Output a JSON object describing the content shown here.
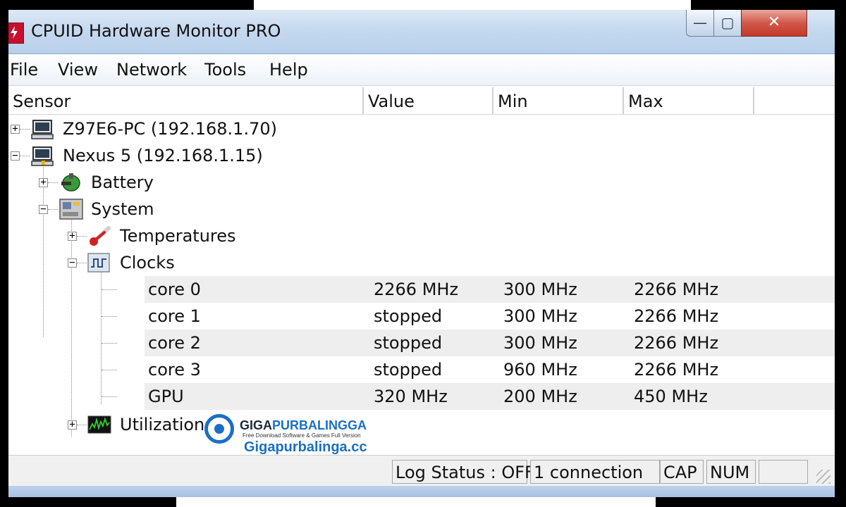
{
  "window": {
    "title": "CPUID Hardware Monitor PRO",
    "controls": {
      "minimize": "—",
      "maximize": "▢",
      "close": "✕"
    }
  },
  "menu": [
    "File",
    "View",
    "Network",
    "Tools",
    "Help"
  ],
  "columns": [
    "Sensor",
    "Value",
    "Min",
    "Max"
  ],
  "tree": {
    "hosts": [
      {
        "label": "Z97E6-PC (192.168.1.70)",
        "expander": "+",
        "icon": "computer-icon"
      },
      {
        "label": "Nexus 5 (192.168.1.15)",
        "expander": "−",
        "icon": "computer-icon"
      }
    ],
    "battery": {
      "label": "Battery",
      "expander": "+",
      "icon": "battery-icon"
    },
    "system": {
      "label": "System",
      "expander": "−",
      "icon": "motherboard-icon"
    },
    "temperatures": {
      "label": "Temperatures",
      "expander": "+",
      "icon": "thermometer-icon"
    },
    "clocks": {
      "label": "Clocks",
      "expander": "−",
      "icon": "clock-signal-icon"
    },
    "clock_rows": [
      {
        "sensor": "core 0",
        "value": "2266 MHz",
        "min": "300 MHz",
        "max": "2266 MHz"
      },
      {
        "sensor": "core 1",
        "value": "stopped",
        "min": "300 MHz",
        "max": "2266 MHz"
      },
      {
        "sensor": "core 2",
        "value": "stopped",
        "min": "300 MHz",
        "max": "2266 MHz"
      },
      {
        "sensor": "core 3",
        "value": "stopped",
        "min": "960 MHz",
        "max": "2266 MHz"
      },
      {
        "sensor": "GPU",
        "value": "320 MHz",
        "min": "200 MHz",
        "max": "450 MHz"
      }
    ],
    "utilizations": {
      "label": "Utilizations",
      "expander": "+",
      "icon": "utilization-graph-icon"
    }
  },
  "status": {
    "log": "Log Status : OFF",
    "connections": "1 connection",
    "cap": "CAP",
    "num": "NUM",
    "blank": ""
  },
  "watermark": {
    "brand_a": "GIGA",
    "brand_b": "PURBALINGGA",
    "tagline": "Free Download Software & Games Full Version",
    "site": "Gigapurbalinga.cc"
  },
  "colors": {
    "title_gradient_top": "#dce9f7",
    "close_button": "#c23a2a",
    "row_shade": "#eeeeee",
    "watermark_blue": "#1a6fc4"
  }
}
